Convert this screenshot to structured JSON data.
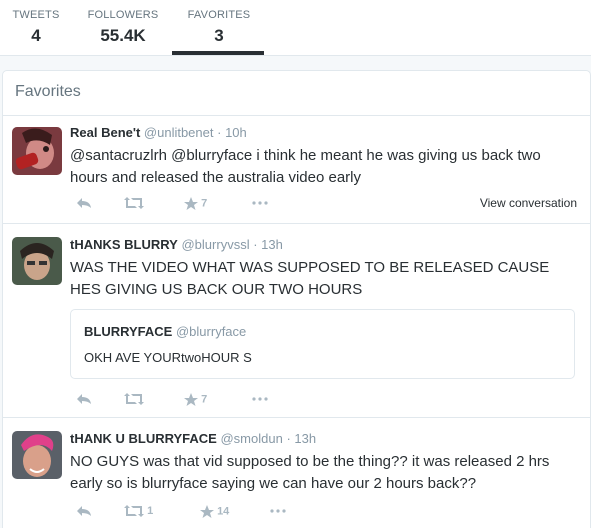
{
  "profile_stats": {
    "tweets_label": "TWEETS",
    "tweets_value": "4",
    "followers_label": "FOLLOWERS",
    "followers_value": "55.4K",
    "favorites_label": "FAVORITES",
    "favorites_value": "3"
  },
  "panel": {
    "title": "Favorites"
  },
  "tweets": [
    {
      "name": "Real Bene't",
      "handle": "@unlitbenet",
      "time": "10h",
      "text": "@santacruzlrh @blurryface i think he meant he was giving us back two hours and released the australia video early",
      "retweets": "",
      "favorites": "7",
      "view_conversation": "View conversation"
    },
    {
      "name": "tHANKS BLURRY",
      "handle": "@blurryvssl",
      "time": "13h",
      "text": "WAS THE VIDEO WHAT WAS SUPPOSED TO BE RELEASED CAUSE HES GIVING US BACK OUR TWO HOURS",
      "retweets": "",
      "favorites": "7",
      "quote": {
        "name": "BLURRYFACE",
        "handle": "@blurryface",
        "text": "OKH AVE YOURtwoHOUR S"
      }
    },
    {
      "name": "tHANK U BLURRYFACE",
      "handle": "@smoldun",
      "time": "13h",
      "text": "NO GUYS was that vid supposed to be the thing?? it was released 2 hrs early so is blurryface saying we can have our 2 hours back??",
      "retweets": "1",
      "favorites": "14"
    }
  ],
  "colors": {
    "muted": "#8899a6",
    "icon": "#aab8c2",
    "border": "#e1e8ed",
    "text": "#292f33"
  },
  "icons": [
    "reply-icon",
    "retweet-icon",
    "favorite-star-icon",
    "more-dots-icon"
  ]
}
